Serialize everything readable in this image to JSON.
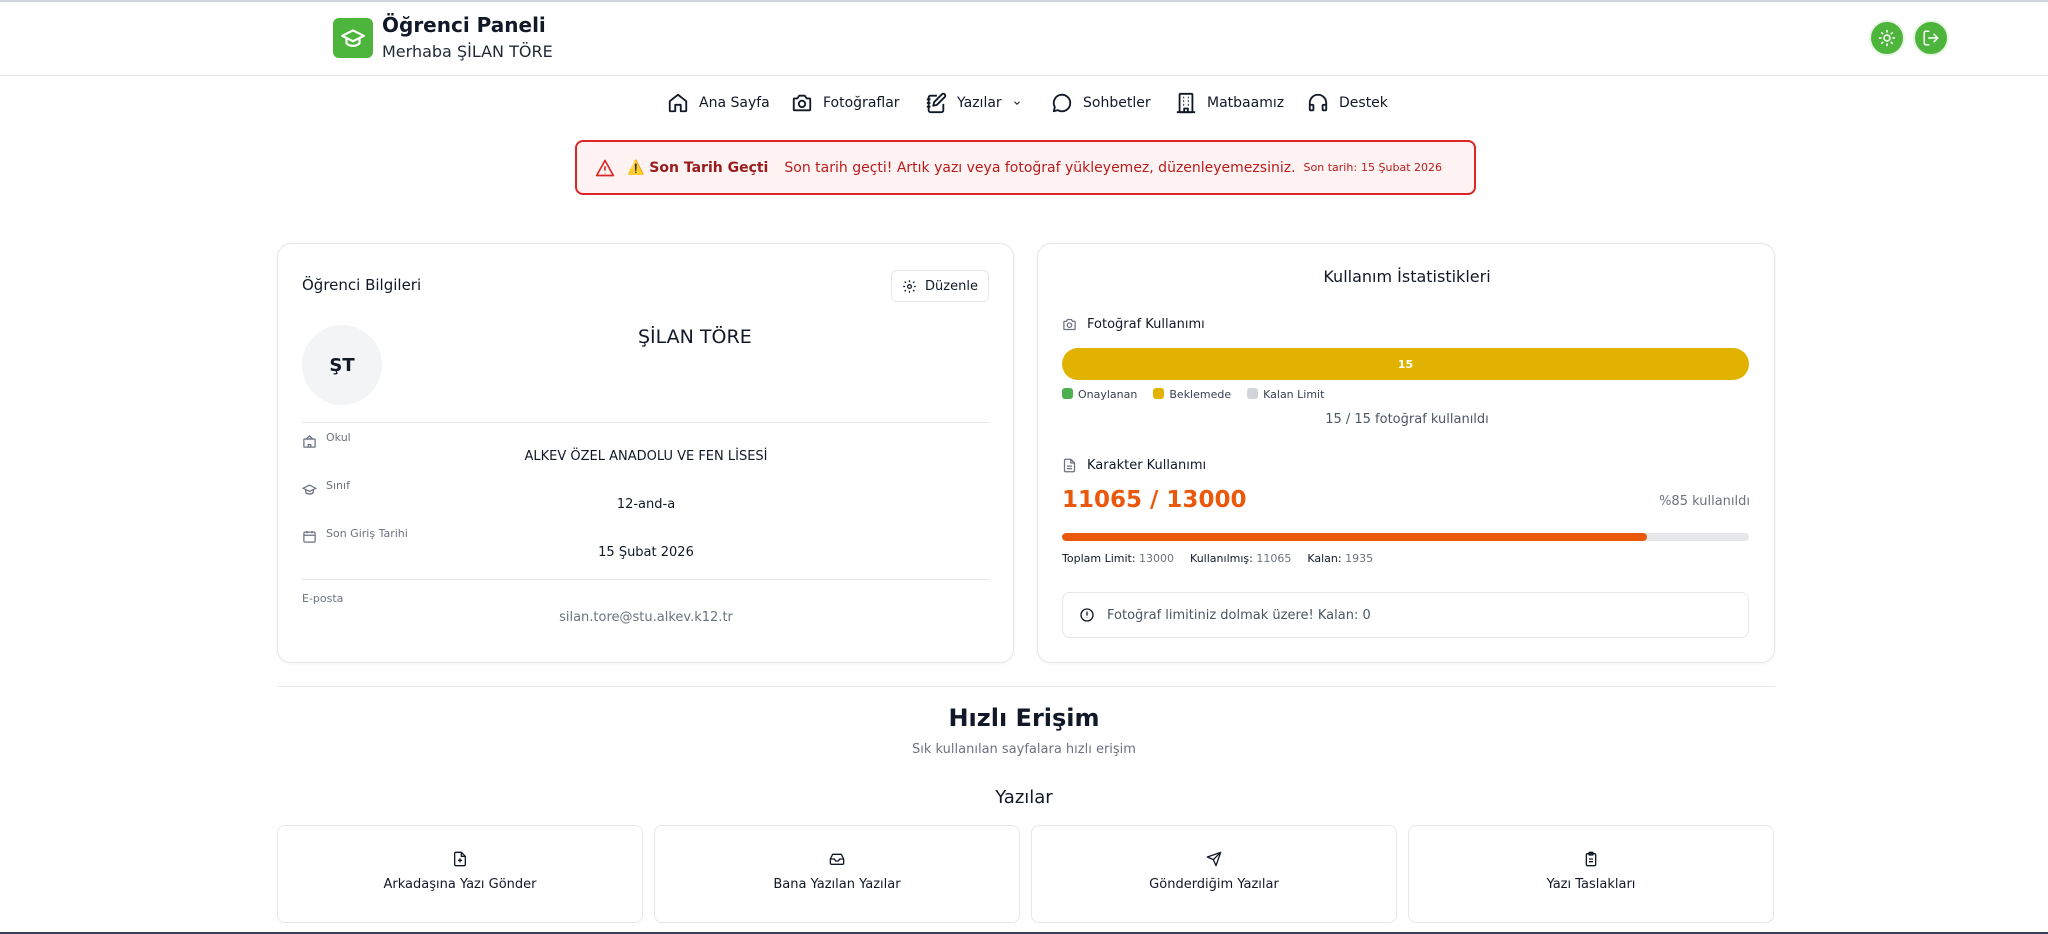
{
  "header": {
    "title": "Öğrenci Paneli",
    "greeting": "Merhaba ŞİLAN TÖRE"
  },
  "nav": {
    "items": [
      {
        "label": "Ana Sayfa",
        "icon": "home-icon"
      },
      {
        "label": "Fotoğraflar",
        "icon": "camera-icon"
      },
      {
        "label": "Yazılar",
        "icon": "notebook-pen-icon"
      },
      {
        "label": "Sohbetler",
        "icon": "chat-bubble-icon"
      },
      {
        "label": "Matbaamız",
        "icon": "building-icon"
      },
      {
        "label": "Destek",
        "icon": "headset-icon"
      }
    ]
  },
  "alert": {
    "title": "⚠️ Son Tarih Geçti",
    "message": "Son tarih geçti! Artık yazı veya fotoğraf yükleyemez, düzenleyemezsiniz.",
    "deadline_label": "Son tarih:",
    "deadline_value": "15 Şubat 2026"
  },
  "student": {
    "card_title": "Öğrenci Bilgileri",
    "edit_label": "Düzenle",
    "initials": "ŞT",
    "name": "ŞİLAN TÖRE",
    "school_label": "Okul",
    "school_value": "ALKEV ÖZEL ANADOLU VE FEN LİSESİ",
    "class_label": "Sınıf",
    "class_value": "12-and-a",
    "last_login_label": "Son Giriş Tarihi",
    "last_login_value": "15 Şubat 2026",
    "email_label": "E-posta",
    "email_value": "silan.tore@stu.alkev.k12.tr"
  },
  "stats": {
    "title": "Kullanım İstatistikleri",
    "photo_label": "Fotoğraf Kullanımı",
    "photo_bar_text": "15",
    "photo_fill_fraction": 1.0,
    "legend": {
      "approved": "Onaylanan",
      "pending": "Beklemede",
      "remaining": "Kalan Limit"
    },
    "photo_count_text": "15 / 15 fotoğraf kullanıldı",
    "char_label": "Karakter Kullanımı",
    "char_big": "11065 / 13000",
    "char_pct": "%85 kullanıldı",
    "char_fill_fraction": 0.851,
    "total_label": "Toplam Limit:",
    "total_value": "13000",
    "used_label": "Kullanılmış:",
    "used_value": "11065",
    "remain_label": "Kalan:",
    "remain_value": "1935",
    "warning": "Fotoğraf limitiniz dolmak üzere! Kalan: 0"
  },
  "quick_access": {
    "title": "Hızlı Erişim",
    "subtitle": "Sık kullanılan sayfalara hızlı erişim",
    "category": "Yazılar",
    "tiles": [
      {
        "label": "Arkadaşına Yazı Gönder",
        "icon": "file-plus-icon"
      },
      {
        "label": "Bana Yazılan Yazılar",
        "icon": "inbox-icon"
      },
      {
        "label": "Gönderdiğim Yazılar",
        "icon": "send-icon"
      },
      {
        "label": "Yazı Taslakları",
        "icon": "clipboard-icon"
      }
    ]
  },
  "colors": {
    "brand_green": "#4db53c",
    "pending_yellow": "#e1b300",
    "approved_green": "#4caf50",
    "char_orange": "#ea580c",
    "alert_red": "#dc2626"
  }
}
